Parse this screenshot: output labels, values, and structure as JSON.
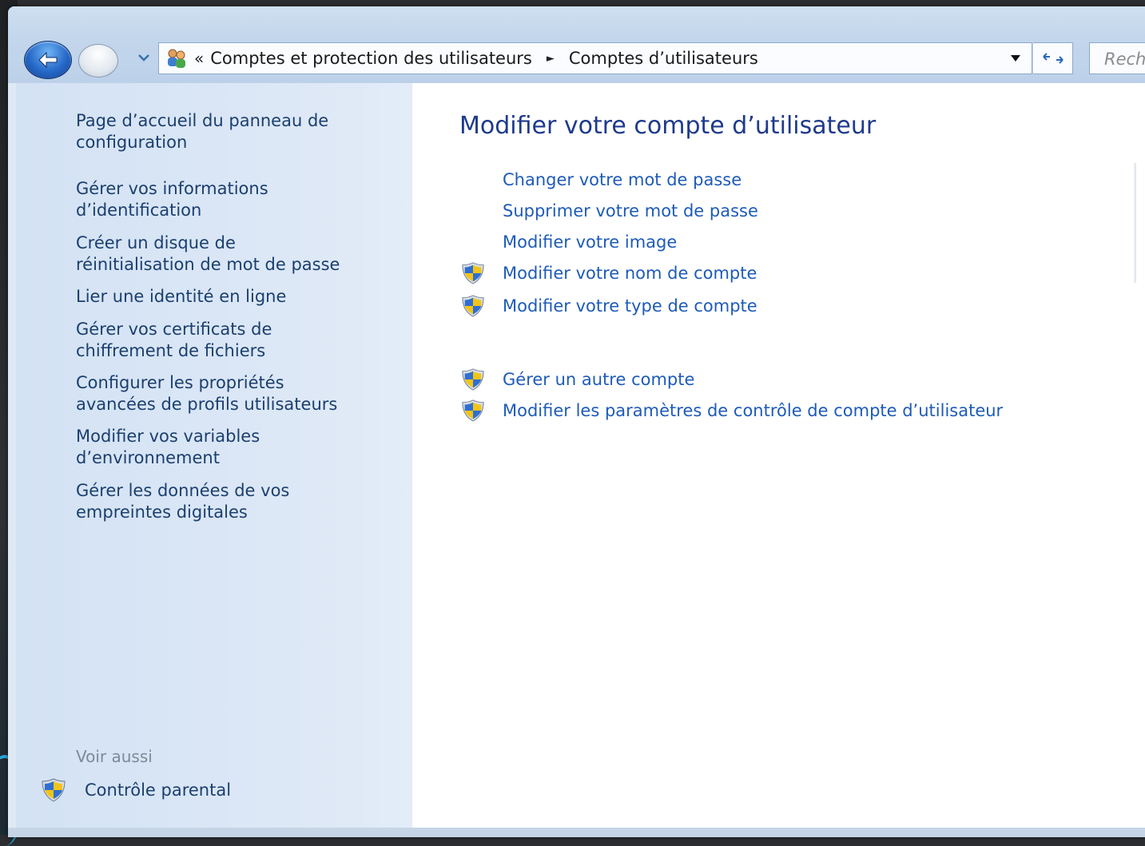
{
  "breadcrumb": {
    "overflow": "«",
    "items": [
      "Comptes et protection des utilisateurs",
      "Comptes d’utilisateurs"
    ],
    "separator": "►"
  },
  "search": {
    "placeholder": "Rech"
  },
  "sidebar": {
    "links": [
      "Page d’accueil du panneau de\nconfiguration",
      "Gérer vos informations\nd’identification",
      "Créer un disque de\nréinitialisation de mot de passe",
      "Lier une identité en ligne",
      "Gérer vos certificats de\nchiffrement de fichiers",
      "Configurer les propriétés\navancées de profils utilisateurs",
      "Modifier vos variables\nd’environnement",
      "Gérer les données de vos\nempreintes digitales"
    ],
    "see_also_label": "Voir aussi",
    "see_also_items": [
      "Contrôle parental"
    ]
  },
  "main": {
    "title": "Modifier votre compte d’utilisateur",
    "tasks": [
      "Changer votre mot de passe",
      "Supprimer votre mot de passe",
      "Modifier votre image",
      "Modifier votre nom de compte",
      "Modifier votre type de compte"
    ],
    "other_tasks": [
      "Gérer un autre compte",
      "Modifier les paramètres de contrôle de compte d’utilisateur"
    ]
  },
  "colors": {
    "link": "#1e5bb8",
    "title": "#1e3a8c",
    "sidebar_link": "#1b3f6e",
    "sidebar_bg": "#d3e2f4"
  },
  "icons": {
    "back": "arrow-left-icon",
    "forward": "arrow-right-icon",
    "address": "users-icon",
    "refresh": "refresh-icon",
    "uac": "uac-shield-icon"
  }
}
